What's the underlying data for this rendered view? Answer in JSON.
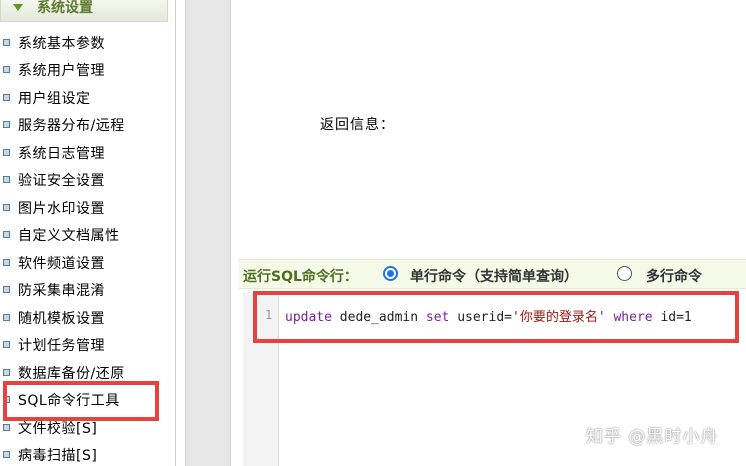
{
  "sidebar": {
    "section_title": "系统设置",
    "items": [
      {
        "label": "系统基本参数"
      },
      {
        "label": "系统用户管理"
      },
      {
        "label": "用户组设定"
      },
      {
        "label": "服务器分布/远程"
      },
      {
        "label": "系统日志管理"
      },
      {
        "label": "验证安全设置"
      },
      {
        "label": "图片水印设置"
      },
      {
        "label": "自定义文档属性"
      },
      {
        "label": "软件频道设置"
      },
      {
        "label": "防采集串混淆"
      },
      {
        "label": "随机模板设置"
      },
      {
        "label": "计划任务管理"
      },
      {
        "label": "数据库备份/还原"
      },
      {
        "label": "SQL命令行工具"
      },
      {
        "label": "文件校验[S]"
      },
      {
        "label": "病毒扫描[S]"
      }
    ]
  },
  "main": {
    "return_info_label": "返回信息：",
    "cmd_label": "运行SQL命令行：",
    "options": [
      {
        "label": "单行命令（支持简单查询）",
        "checked": true
      },
      {
        "label": "多行命令",
        "checked": false
      }
    ],
    "editor": {
      "line_number": "1",
      "code_update": "update",
      "code_table": " dede_admin ",
      "code_set": "set",
      "code_field": " userid=",
      "code_value": "'你要的登录名'",
      "code_where": " where",
      "code_cond": " id=1"
    }
  },
  "watermark": "知乎 @黑时小舟",
  "colors": {
    "highlight": "#e8423f",
    "section_title": "#5d7a2e",
    "radio_accent": "#1a73e8"
  }
}
